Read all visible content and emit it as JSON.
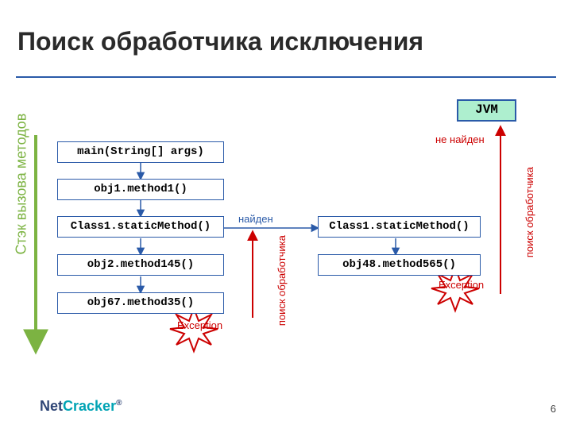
{
  "title": "Поиск обработчика исключения",
  "stack_label": "Стэк вызова методов",
  "jvm_label": "JVM",
  "left_stack": [
    "main(String[] args)",
    "obj1.method1()",
    "Class1.staticMethod()",
    "obj2.method145()",
    "obj67.method35()"
  ],
  "right_stack": [
    "Class1.staticMethod()",
    "obj48.method565()"
  ],
  "labels": {
    "found": "найден",
    "not_found": "не найден",
    "search_handler": "поиск обработчика",
    "exception": "Exception"
  },
  "page_number": "6",
  "logo": {
    "part1": "Net",
    "part2": "Cracker"
  }
}
